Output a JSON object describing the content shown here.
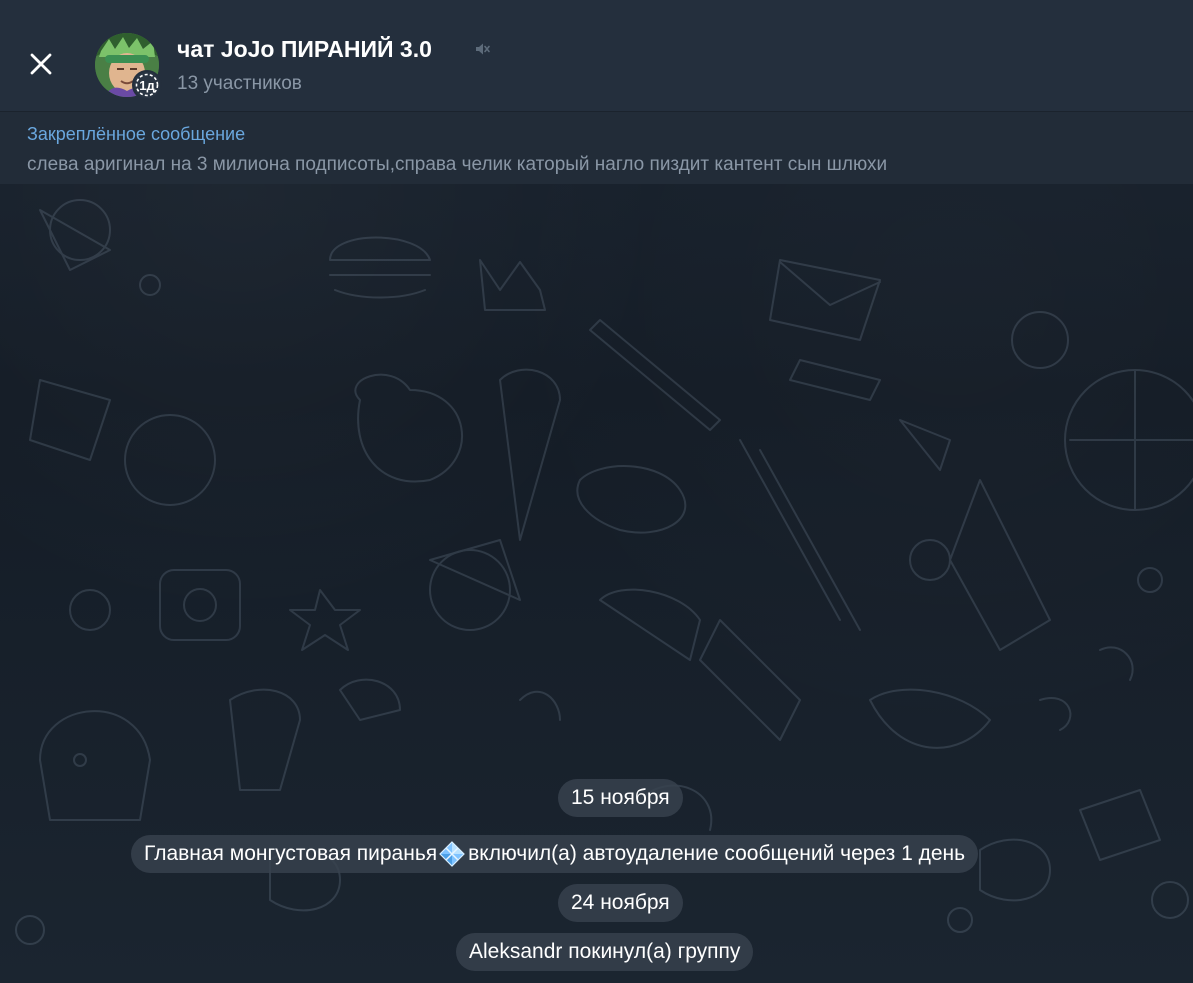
{
  "header": {
    "title": "чат JoJo ПИРАНИЙ 3.0",
    "subtitle": "13 участников",
    "timer_badge": "1д",
    "icons": {
      "close": "close-icon",
      "mute": "mute-icon",
      "timer": "timer-icon"
    }
  },
  "pinned": {
    "label": "Закреплённое сообщение",
    "text": "слева аригинал на 3 милиона подписоты,справа челик каторый нагло пиздит кантент сын шлюхи"
  },
  "messages": [
    {
      "type": "date",
      "text": "15 ноября"
    },
    {
      "type": "service",
      "actor": "Главная монгустовая пиранья",
      "icon": "gem-icon",
      "text": " включил(а) автоудаление сообщений через 1 день"
    },
    {
      "type": "date",
      "text": "24 ноября"
    },
    {
      "type": "service",
      "text": "Aleksandr покинул(а) группу"
    }
  ],
  "colors": {
    "header_bg": "#242f3d",
    "pinned_label": "#6aa7de",
    "muted_text": "#8a97a6",
    "service_bg": "#38424e"
  }
}
